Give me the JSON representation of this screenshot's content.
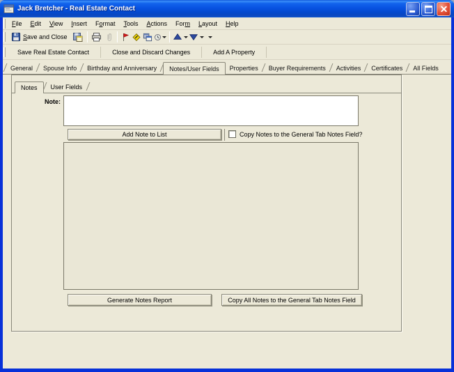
{
  "window": {
    "title": "Jack Bretcher - Real Estate Contact",
    "controls": [
      "minimize",
      "maximize",
      "close"
    ]
  },
  "menu": {
    "items": [
      {
        "label": "File",
        "u": 0
      },
      {
        "label": "Edit",
        "u": 0
      },
      {
        "label": "View",
        "u": 0
      },
      {
        "label": "Insert",
        "u": 0
      },
      {
        "label": "Format",
        "u": 1
      },
      {
        "label": "Tools",
        "u": 0
      },
      {
        "label": "Actions",
        "u": 0
      },
      {
        "label": "Form",
        "u": 3
      },
      {
        "label": "Layout",
        "u": 0
      },
      {
        "label": "Help",
        "u": 0
      }
    ]
  },
  "toolbar": {
    "save_and_close": {
      "label": "Save and Close",
      "u": 0
    },
    "icons": [
      "save-form",
      "print",
      "attach",
      "flag",
      "note-diamond",
      "forms",
      "history",
      "previous-item",
      "next-item",
      "toolbar-options"
    ]
  },
  "command_bar": {
    "buttons": [
      "Save Real Estate Contact",
      "Close and Discard Changes",
      "Add A Property"
    ]
  },
  "tabs": {
    "active_index": 3,
    "items": [
      "General",
      "Spouse Info",
      "Birthday and Anniversary",
      "Notes/User Fields",
      "Properties",
      "Buyer Requirements",
      "Activities",
      "Certificates",
      "All Fields"
    ]
  },
  "subtabs": {
    "active_index": 0,
    "items": [
      "Notes",
      "User Fields"
    ]
  },
  "notes_page": {
    "note_label": "Note:",
    "note_value": "",
    "add_note_button": "Add Note to List",
    "copy_checkbox_label": "Copy Notes to the General Tab Notes Field?",
    "copy_checkbox_checked": false,
    "notes_list": [],
    "generate_report_button": "Generate Notes Report",
    "copy_all_button": "Copy All Notes to the General Tab Notes Field"
  },
  "colors": {
    "face": "#ece9d8",
    "titlebar_blue": "#0a53e0",
    "window_border": "#0831d9",
    "flag_red": "#d01818",
    "note_yellow": "#f2d80a",
    "nav_arrow_blue": "#2c4aa0"
  }
}
